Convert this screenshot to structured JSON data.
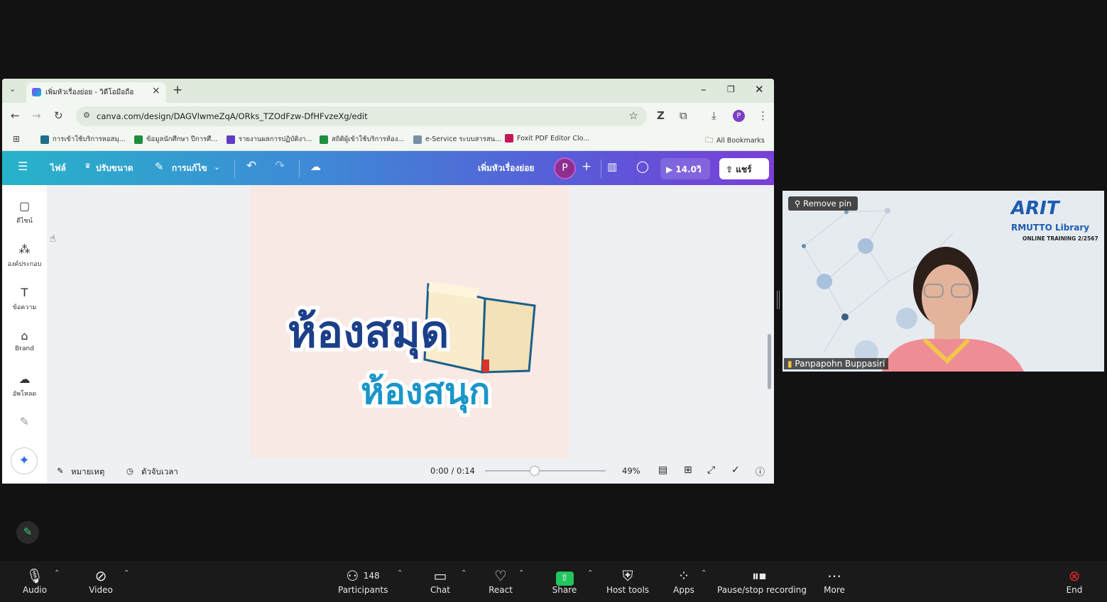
{
  "browser": {
    "tab_title": "เพิ่มหัวเรื่องย่อย - วิดีโอมือถือ",
    "url": "canva.com/design/DAGVlwmeZqA/ORks_TZOdFzw-DfHFvzeXg/edit",
    "profile_initial": "P",
    "bookmarks": [
      {
        "label": "การเข้าใช้บริการหอสมุ...",
        "color": "#1f6f8b"
      },
      {
        "label": "ข้อมูลนักศึกษา ปีการศึ...",
        "color": "#1e8e3e"
      },
      {
        "label": "รายงานผลการปฏิบัติงา...",
        "color": "#5f3dc4"
      },
      {
        "label": "สถิติผู้เข้าใช้บริการห้อง...",
        "color": "#1e8e3e"
      },
      {
        "label": "e-Service ระบบสารสน...",
        "color": "#7a8fa6"
      },
      {
        "label": "Foxit PDF Editor Clo...",
        "color": "#c2185b"
      }
    ],
    "all_bookmarks": "All Bookmarks"
  },
  "canva": {
    "menu_file": "ไฟล์",
    "menu_resize": "ปรับขนาด",
    "menu_edit": "การแก้ไข",
    "design_title": "เพิ่มหัวเรื่องย่อย",
    "avatar_initial": "P",
    "play_label": "14.0วิ",
    "share_label": "แชร์",
    "sidebar": [
      {
        "icon": "▢",
        "label": "ดีไซน์",
        "name": "design"
      },
      {
        "icon": "⁂",
        "label": "องค์ประกอบ",
        "name": "elements"
      },
      {
        "icon": "T",
        "label": "ข้อความ",
        "name": "text"
      },
      {
        "icon": "⌂",
        "label": "Brand",
        "name": "brand"
      },
      {
        "icon": "☁",
        "label": "อัพโหลด",
        "name": "uploads"
      },
      {
        "icon": "✎",
        "label": "",
        "name": "draw"
      }
    ],
    "canvas_line1": "ห้องสมุด",
    "canvas_line2": "ห้องสนุก",
    "notes_label": "หมายเหตุ",
    "timer_label": "ตัวจับเวลา",
    "time_display": "0:00 / 0:14",
    "playback_position": 0.41,
    "zoom": "49%"
  },
  "video": {
    "remove_pin": "Remove pin",
    "participant_name": "Panpapohn Buppasiri",
    "logo_main": "ARIT",
    "logo_sub": "RMUTTO Library",
    "logo_sub2": "ONLINE TRAINING 2/2567"
  },
  "zoom_toolbar": {
    "audio": "Audio",
    "video": "Video",
    "participants": "Participants",
    "participants_count": "148",
    "chat": "Chat",
    "react": "React",
    "share": "Share",
    "host_tools": "Host tools",
    "apps": "Apps",
    "recording": "Pause/stop recording",
    "more": "More",
    "end": "End",
    "share_color": "#22c55e",
    "end_color": "#e02828"
  }
}
